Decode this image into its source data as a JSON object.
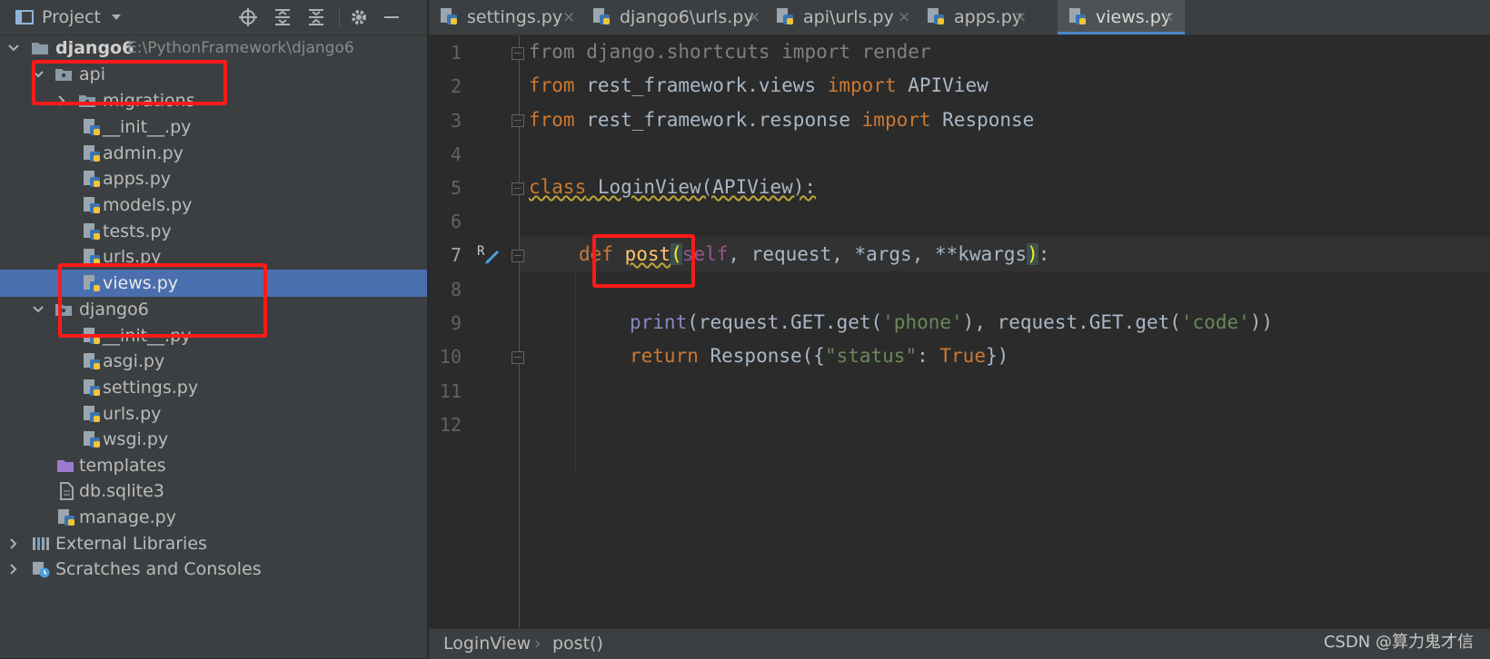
{
  "project_panel": {
    "title": "Project",
    "tree": [
      {
        "label": "django6",
        "path": "E:\\PythonFramework\\django6",
        "expanded": true
      },
      {
        "label": "api",
        "expanded": true
      },
      {
        "label": "migrations",
        "expanded": false
      },
      {
        "label": "__init__.py"
      },
      {
        "label": "admin.py"
      },
      {
        "label": "apps.py"
      },
      {
        "label": "models.py"
      },
      {
        "label": "tests.py"
      },
      {
        "label": "urls.py"
      },
      {
        "label": "views.py",
        "selected": true
      },
      {
        "label": "django6",
        "expanded": true
      },
      {
        "label": "__init__.py"
      },
      {
        "label": "asgi.py"
      },
      {
        "label": "settings.py"
      },
      {
        "label": "urls.py"
      },
      {
        "label": "wsgi.py"
      },
      {
        "label": "templates"
      },
      {
        "label": "db.sqlite3"
      },
      {
        "label": "manage.py"
      },
      {
        "label": "External Libraries",
        "expanded": false
      },
      {
        "label": "Scratches and Consoles",
        "expanded": false
      }
    ]
  },
  "tabs": [
    {
      "label": "settings.py",
      "active": false
    },
    {
      "label": "django6\\urls.py",
      "active": false
    },
    {
      "label": "api\\urls.py",
      "active": false
    },
    {
      "label": "apps.py",
      "active": false
    },
    {
      "label": "views.py",
      "active": true
    }
  ],
  "tab_close_glyph": "×",
  "editor": {
    "line_numbers": [
      "1",
      "2",
      "3",
      "4",
      "5",
      "6",
      "7",
      "8",
      "9",
      "10",
      "11",
      "12"
    ],
    "current_line": "7",
    "lines": {
      "l1": {
        "a": "from",
        "b": " django.shortcuts ",
        "c": "import",
        "d": " render"
      },
      "l2": {
        "a": "from",
        "b": " rest_framework.views ",
        "c": "import",
        "d": " APIView"
      },
      "l3": {
        "a": "from",
        "b": " rest_framework.response ",
        "c": "import",
        "d": " Response"
      },
      "l5": {
        "a": "class",
        "b": " LoginView(APIView):"
      },
      "l7": {
        "a": "def",
        "b": "post",
        "c": "(",
        "d": "self",
        "e": ", request, *args, **kwargs",
        "f": ")",
        "g": ":"
      },
      "l9": {
        "a": "print",
        "b": "(request.GET.get(",
        "c": "'phone'",
        "d": "), request.GET.get(",
        "e": "'code'",
        "f": "))"
      },
      "l10": {
        "a": "return",
        "b": " Response({",
        "c": "\"status\"",
        "d": ": ",
        "e": "True",
        "f": "})"
      }
    }
  },
  "breadcrumb": {
    "items": [
      "LoginView",
      "post()"
    ],
    "separator": "›"
  },
  "watermark": "CSDN @算力鬼才信",
  "colors": {
    "keyword": "#cc7832",
    "function": "#ffc66d",
    "string": "#6a8759",
    "selection": "#4b6eaf",
    "annotation_box": "#ff1a1a"
  }
}
